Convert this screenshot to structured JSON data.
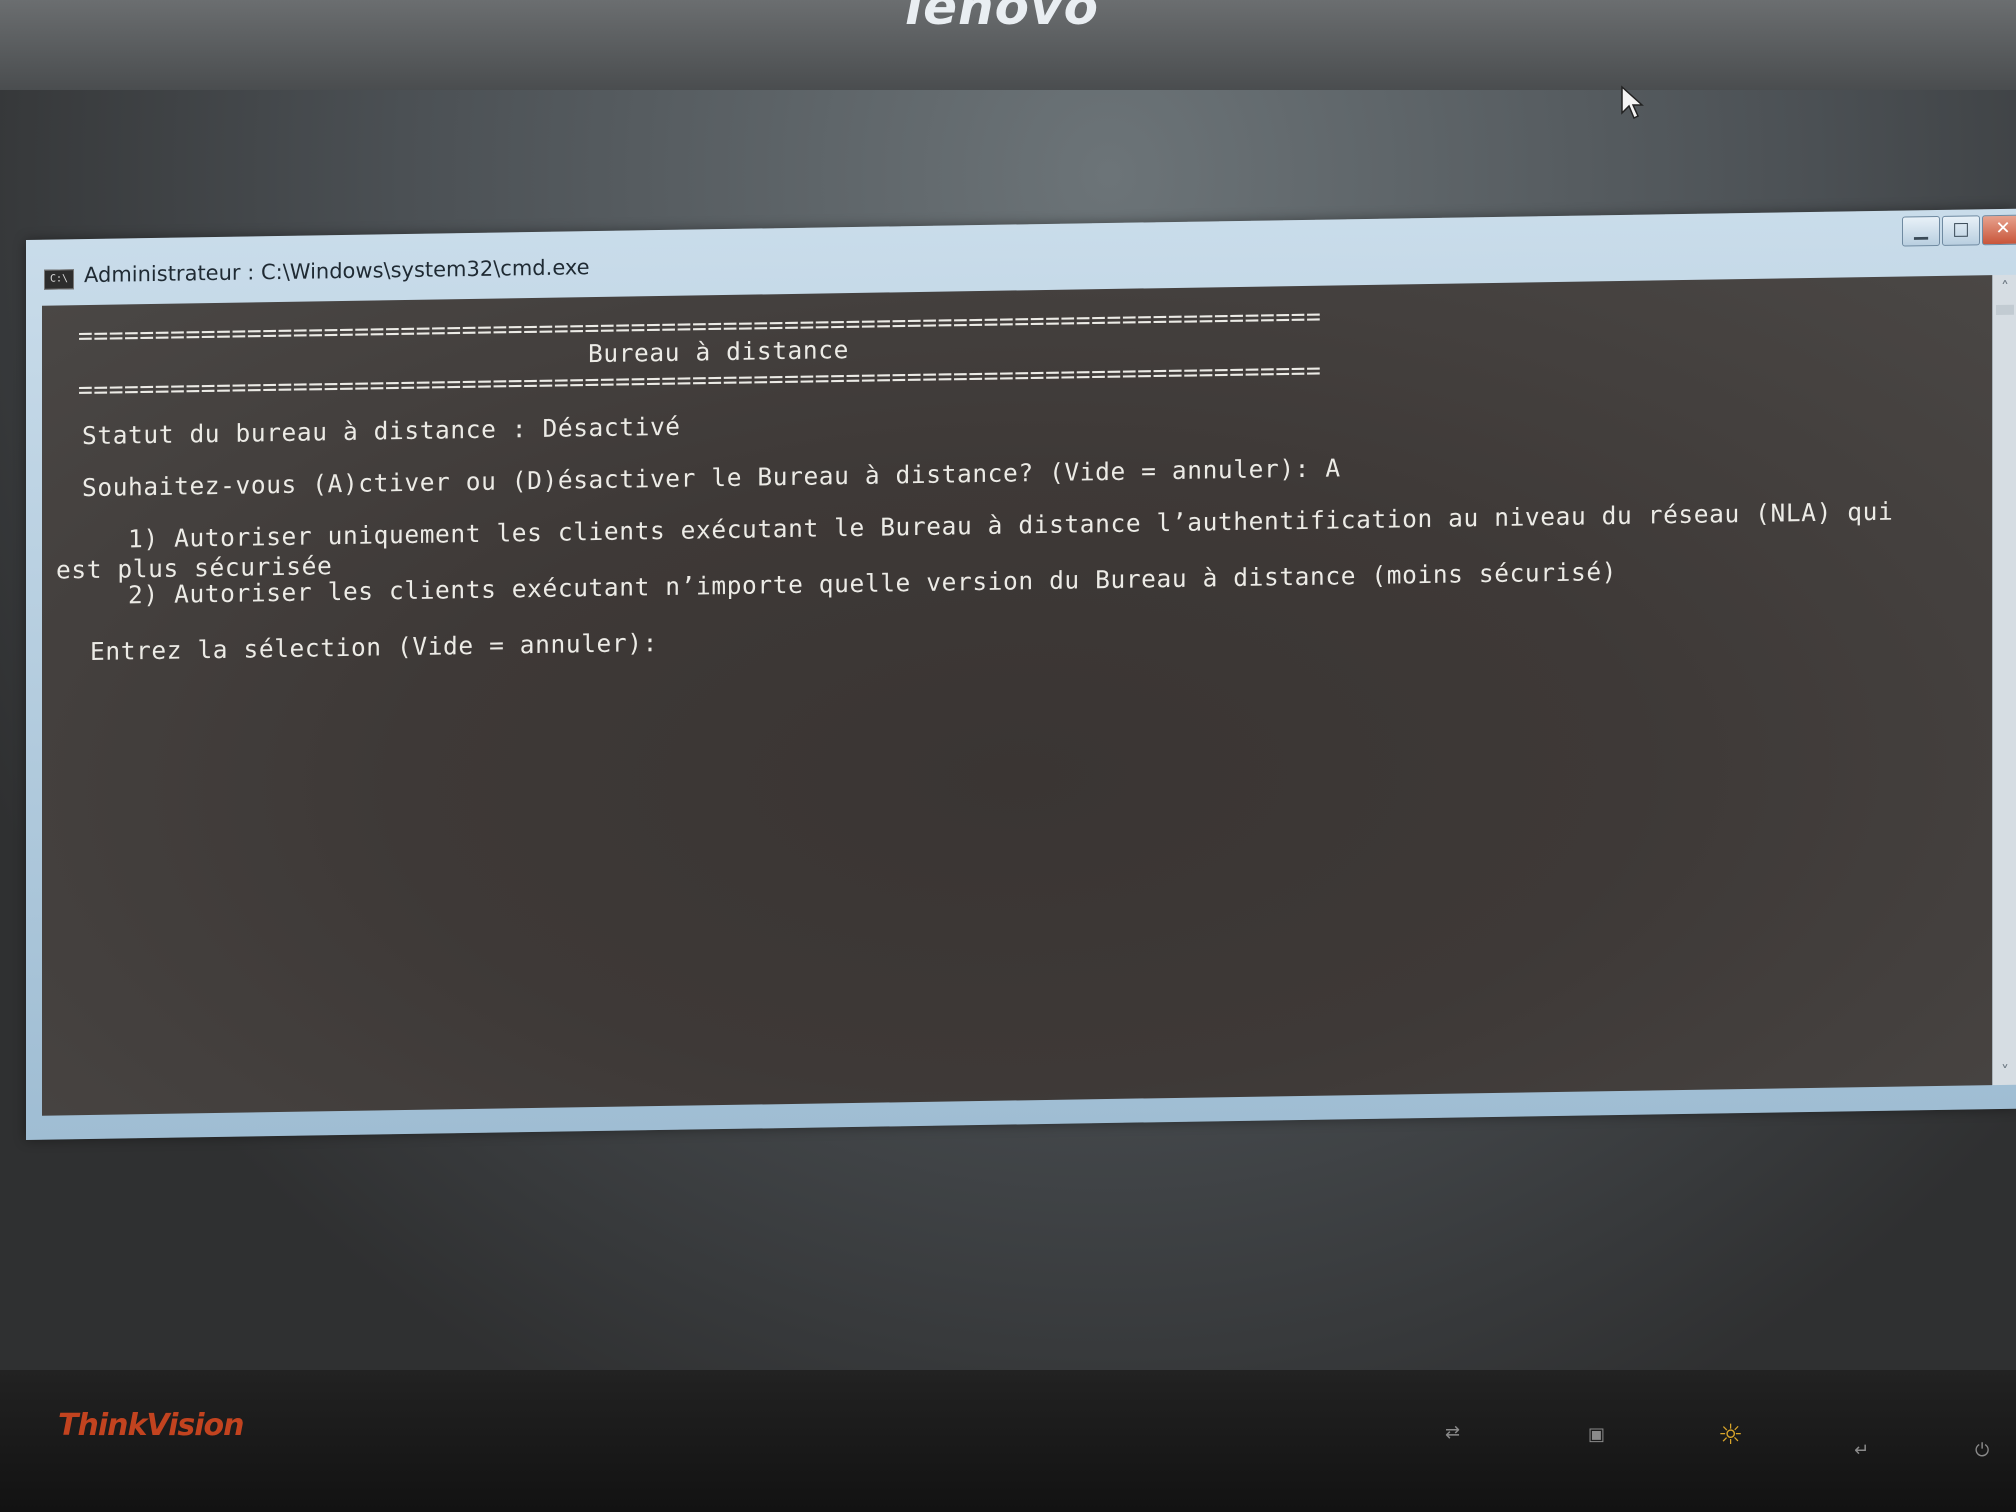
{
  "monitor": {
    "brand_top": "lenovo",
    "brand_bottom": "ThinkVision",
    "controls": {
      "input_icon": "input-switch-icon",
      "menu_icon": "menu-icon",
      "brightness_icon": "brightness-icon",
      "enter_icon": "enter-icon",
      "power_icon": "power-icon"
    }
  },
  "window": {
    "title": "Administrateur : C:\\Windows\\system32\\cmd.exe",
    "icon_label": "C:\\",
    "buttons": {
      "minimize": "▁",
      "maximize": "□",
      "close": "✕"
    }
  },
  "console": {
    "separator": "=================================================================================",
    "heading": "Bureau à distance",
    "status": "Statut du bureau à distance : Désactivé",
    "prompt_toggle": "Souhaitez-vous (A)ctiver ou (D)ésactiver le Bureau à distance? (Vide = annuler): A",
    "option1_line1": "   1) Autoriser uniquement les clients exécutant le Bureau à distance l’authentification au niveau du réseau (NLA) qui",
    "option1_line2": "est plus sécurisée",
    "option2": "   2) Autoriser les clients exécutant n’importe quelle version du Bureau à distance (moins sécurisé)",
    "prompt_selection": "Entrez la sélection (Vide = annuler):"
  },
  "colors": {
    "console_text": "#ecebe6",
    "console_bg": "#3e3937",
    "titlebar": "#b6cee0",
    "thinkvision_logo": "#c2431f"
  }
}
